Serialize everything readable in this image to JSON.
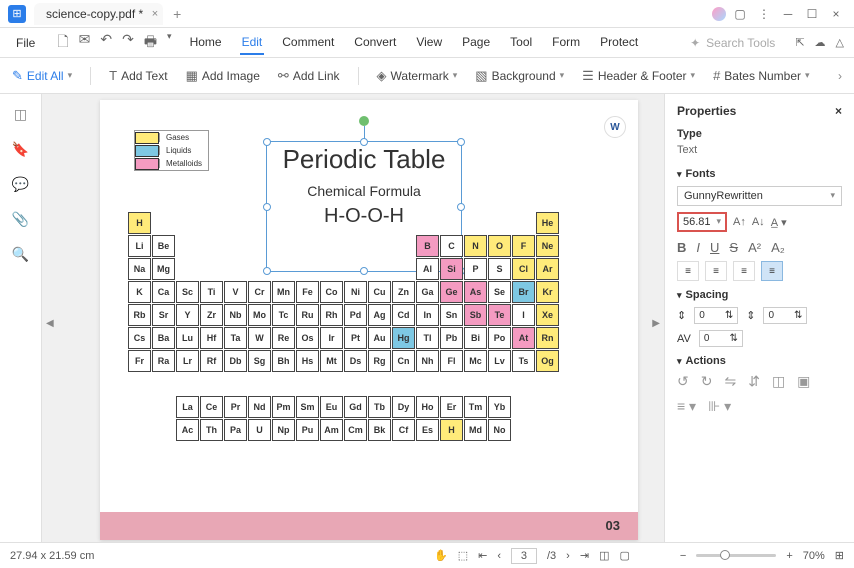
{
  "app": {
    "tab_title": "science-copy.pdf *"
  },
  "menu": {
    "file": "File",
    "tabs": [
      "Home",
      "Edit",
      "Comment",
      "Convert",
      "View",
      "Page",
      "Tool",
      "Form",
      "Protect"
    ],
    "active": 1,
    "search_placeholder": "Search Tools"
  },
  "toolbar": {
    "edit_all": "Edit All",
    "add_text": "Add Text",
    "add_image": "Add Image",
    "add_link": "Add Link",
    "watermark": "Watermark",
    "background": "Background",
    "header_footer": "Header & Footer",
    "bates": "Bates Number"
  },
  "legend": {
    "gases": "Gases",
    "liquids": "Liquids",
    "metalloids": "Metalloids"
  },
  "textbox": {
    "title": "Periodic Table",
    "subtitle": "Chemical Formula",
    "formula": "H-O-O-H"
  },
  "page_num": "03",
  "elements": {
    "r1": [
      "H",
      "He"
    ],
    "r2l": [
      "Li",
      "Be"
    ],
    "r2r": [
      "B",
      "C",
      "N",
      "O",
      "F",
      "Ne"
    ],
    "r3l": [
      "Na",
      "Mg"
    ],
    "r3r": [
      "Al",
      "Si",
      "P",
      "S",
      "Cl",
      "Ar"
    ],
    "r4l": [
      "K",
      "Ca"
    ],
    "r4m": [
      "Sc",
      "Ti",
      "V",
      "Cr",
      "Mn",
      "Fe",
      "Co",
      "Ni",
      "Cu",
      "Zn"
    ],
    "r4r": [
      "Ga",
      "Ge",
      "As",
      "Se",
      "Br",
      "Kr"
    ],
    "r5l": [
      "Rb",
      "Sr"
    ],
    "r5m": [
      "Y",
      "Zr",
      "Nb",
      "Mo",
      "Tc",
      "Ru",
      "Rh",
      "Pd",
      "Ag",
      "Cd"
    ],
    "r5r": [
      "In",
      "Sn",
      "Sb",
      "Te",
      "I",
      "Xe"
    ],
    "r6l": [
      "Cs",
      "Ba"
    ],
    "r6m": [
      "Lu",
      "Hf",
      "Ta",
      "W",
      "Re",
      "Os",
      "Ir",
      "Pt",
      "Au",
      "Hg"
    ],
    "r6r": [
      "Tl",
      "Pb",
      "Bi",
      "Po",
      "At",
      "Rn"
    ],
    "r7l": [
      "Fr",
      "Ra"
    ],
    "r7m": [
      "Lr",
      "Rf",
      "Db",
      "Sg",
      "Bh",
      "Hs",
      "Mt",
      "Ds",
      "Rg",
      "Cn"
    ],
    "r7r": [
      "Nh",
      "Fl",
      "Mc",
      "Lv",
      "Ts",
      "Og"
    ],
    "la": [
      "La",
      "Ce",
      "Pr",
      "Nd",
      "Pm",
      "Sm",
      "Eu",
      "Gd",
      "Tb",
      "Dy",
      "Ho",
      "Er",
      "Tm",
      "Yb"
    ],
    "ac": [
      "Ac",
      "Th",
      "Pa",
      "U",
      "Np",
      "Pu",
      "Am",
      "Cm",
      "Bk",
      "Cf",
      "Es",
      "H",
      "Md",
      "No"
    ]
  },
  "props": {
    "header": "Properties",
    "type_label": "Type",
    "type_val": "Text",
    "fonts_label": "Fonts",
    "font_name": "GunnyRewritten",
    "font_size": "56.81",
    "spacing_label": "Spacing",
    "line_sp": "0",
    "para_sp": "0",
    "char_sp": "0",
    "actions_label": "Actions"
  },
  "status": {
    "dims": "27.94 x 21.59 cm",
    "page": "3",
    "total": "/3",
    "zoom": "70%"
  }
}
